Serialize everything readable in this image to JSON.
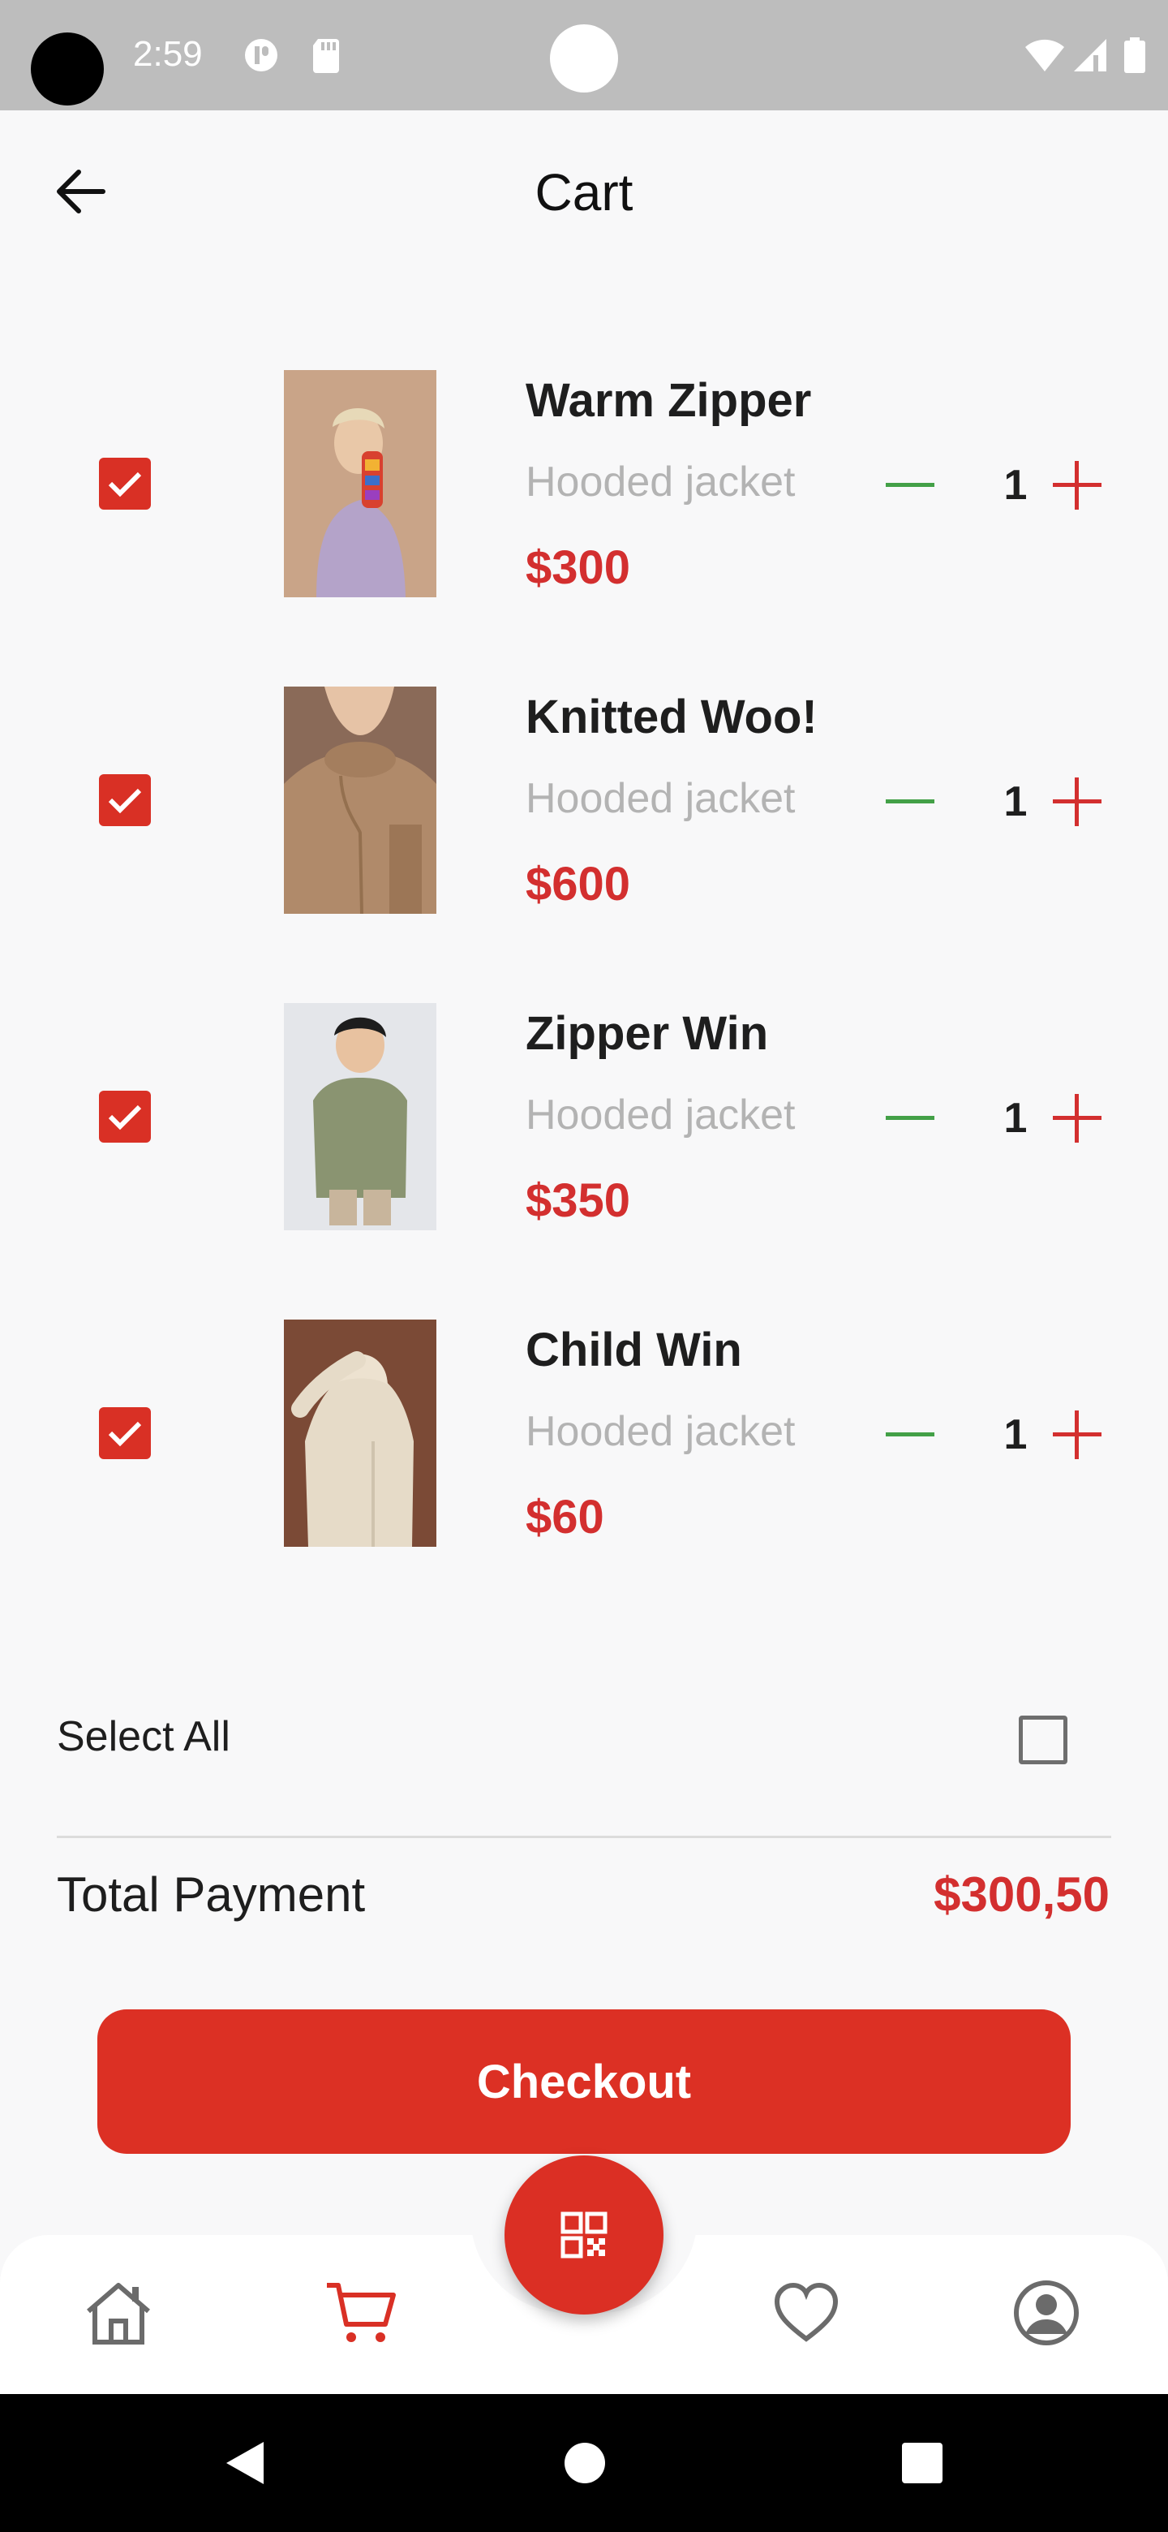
{
  "status_bar": {
    "time": "2:59"
  },
  "header": {
    "title": "Cart"
  },
  "items": [
    {
      "name": "Warm Zipper",
      "subtitle": "Hooded jacket",
      "price": "$300",
      "quantity": "1",
      "checked": true
    },
    {
      "name": "Knitted Woo!",
      "subtitle": "Hooded jacket",
      "price": "$600",
      "quantity": "1",
      "checked": true
    },
    {
      "name": "Zipper Win",
      "subtitle": "Hooded jacket",
      "price": "$350",
      "quantity": "1",
      "checked": true
    },
    {
      "name": "Child Win",
      "subtitle": "Hooded jacket",
      "price": "$60",
      "quantity": "1",
      "checked": true
    }
  ],
  "summary": {
    "select_all_label": "Select All",
    "select_all_checked": false,
    "total_label": "Total Payment",
    "total_value": "$300,50"
  },
  "checkout": {
    "label": "Checkout"
  },
  "bottom_nav": {
    "items": [
      {
        "icon": "home-icon",
        "active": false
      },
      {
        "icon": "cart-icon",
        "active": true
      },
      {
        "icon": "qr-code-icon",
        "active": false
      },
      {
        "icon": "heart-icon",
        "active": false
      },
      {
        "icon": "profile-icon",
        "active": false
      }
    ]
  },
  "colors": {
    "accent": "#dc3024",
    "price": "#d32f2f",
    "minus": "#43a047",
    "muted_text": "#b3b3b3"
  }
}
